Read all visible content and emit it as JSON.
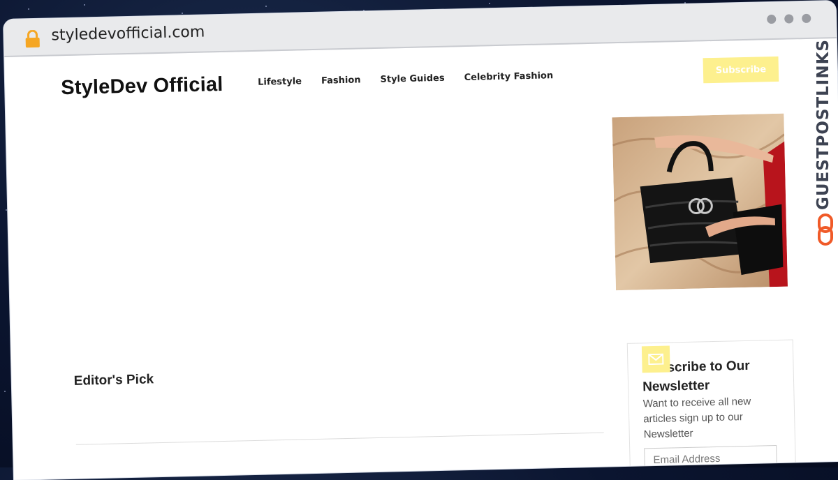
{
  "browser": {
    "url": "styledevofficial.com"
  },
  "site": {
    "brand": "StyleDev Official",
    "nav": [
      "Lifestyle",
      "Fashion",
      "Style Guides",
      "Celebrity Fashion"
    ],
    "subscribe_label": "Subscribe"
  },
  "main": {
    "editors_pick": "Editor's Pick"
  },
  "newsletter": {
    "title": "Subscribe to Our Newsletter",
    "description": "Want to receive all new articles sign up to our Newsletter",
    "email_placeholder": "Email Address"
  },
  "watermark": {
    "text": "GUESTPOSTLINKS"
  },
  "colors": {
    "accent_yellow": "#fdf08e",
    "watermark_orange": "#f05a28"
  }
}
